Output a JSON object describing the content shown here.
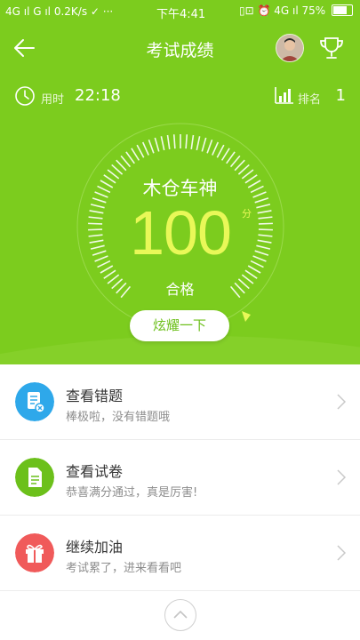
{
  "status_bar": {
    "left": "4G ıl G ıl 0.2K/s ✓ ···",
    "time": "下午4:41",
    "battery": "75%",
    "right_prefix": "▯⊡ ⏰ 4G ıl"
  },
  "header": {
    "title": "考试成绩"
  },
  "stats": {
    "time_label": "用时",
    "time_value": "22:18",
    "rank_label": "排名",
    "rank_value": "1"
  },
  "result": {
    "user_name": "木仓车神",
    "score": "100",
    "unit": "分",
    "verdict": "合格",
    "share_label": "炫耀一下"
  },
  "menu": [
    {
      "title": "查看错题",
      "subtitle": "棒极啦，没有错题哦",
      "icon": "wrong-questions-icon",
      "color": "#2ea8ea"
    },
    {
      "title": "查看试卷",
      "subtitle": "恭喜满分通过，真是厉害!",
      "icon": "exam-paper-icon",
      "color": "#6cc01b"
    },
    {
      "title": "继续加油",
      "subtitle": "考试累了，进来看看吧",
      "icon": "gift-icon",
      "color": "#f05a5a"
    }
  ],
  "colors": {
    "hero": "#7ccc1e",
    "score": "#e9f858"
  }
}
